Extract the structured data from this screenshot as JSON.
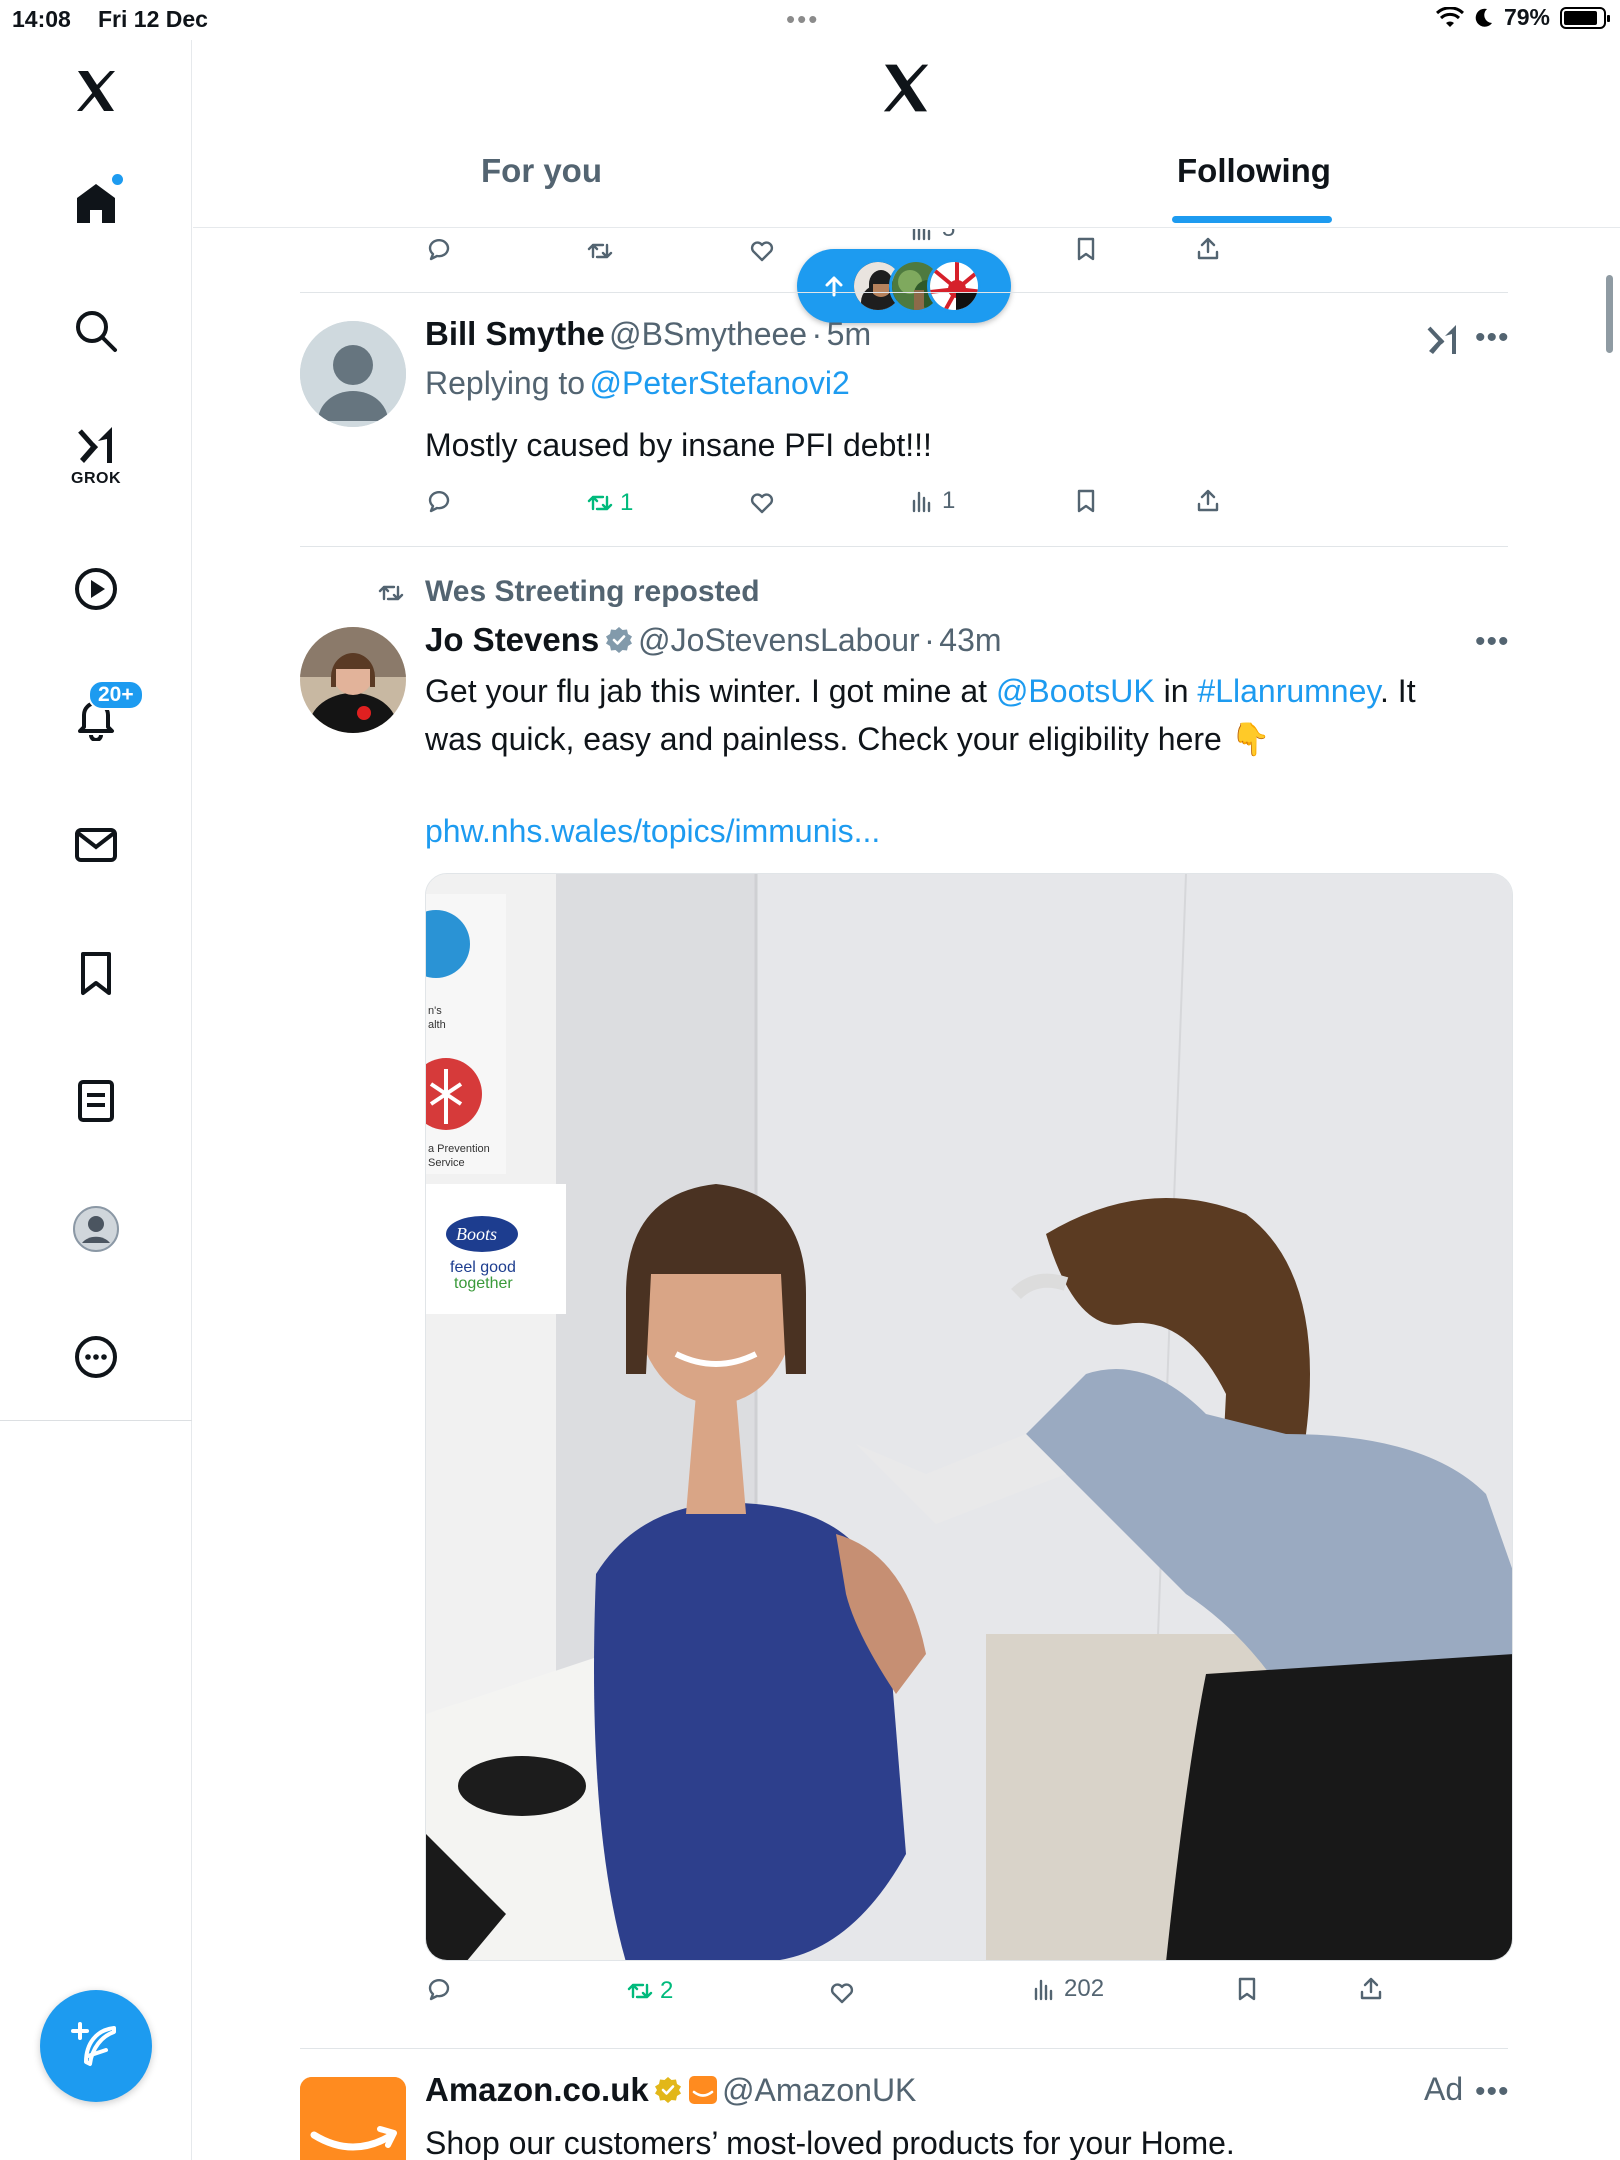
{
  "status_bar": {
    "time": "14:08",
    "date": "Fri 12 Dec",
    "battery": "79%",
    "battery_level": 0.79
  },
  "sidebar": {
    "items": [
      {
        "name": "home",
        "icon": "home-icon",
        "active": true,
        "dot": true
      },
      {
        "name": "explore",
        "icon": "search-icon"
      },
      {
        "name": "grok",
        "icon": "grok-icon",
        "label": "GROK"
      },
      {
        "name": "video",
        "icon": "play-icon"
      },
      {
        "name": "notifications",
        "icon": "bell-icon",
        "badge": "20+"
      },
      {
        "name": "messages",
        "icon": "mail-icon"
      },
      {
        "name": "bookmarks",
        "icon": "bookmark-icon"
      },
      {
        "name": "articles",
        "icon": "article-icon"
      },
      {
        "name": "profile",
        "icon": "profile-icon"
      },
      {
        "name": "more",
        "icon": "more-icon"
      }
    ],
    "compose_icon": "compose-icon"
  },
  "header": {
    "tabs": [
      {
        "label": "For you",
        "active": false
      },
      {
        "label": "Following",
        "active": true
      }
    ]
  },
  "new_posts_pill": {
    "icon": "arrow-up-icon"
  },
  "tweets": [
    {
      "partial": true,
      "actions": {
        "views": "5"
      }
    },
    {
      "name": "Bill Smythe",
      "handle": "@BSmytheee",
      "time": "5m",
      "replying_to_prefix": "Replying to",
      "replying_to": "@PeterStefanovi2",
      "text": "Mostly caused by insane PFI debt!!!",
      "actions": {
        "replies": "",
        "reposts": "1",
        "likes": "",
        "views": "1"
      }
    },
    {
      "reposted_by": "Wes Streeting reposted",
      "name": "Jo Stevens",
      "verified": true,
      "handle": "@JoStevensLabour",
      "time": "43m",
      "text_parts": [
        "Get your flu jab this winter. I got mine at ",
        "@BootsUK",
        " in ",
        "#Llanrumney",
        ". It",
        "was quick, easy and painless. Check your eligibility here",
        "👇"
      ],
      "link": "phw.nhs.wales/topics/immunis...",
      "media": {
        "description_labels": [
          "n's",
          "alth",
          "a Prevention",
          "Service",
          "Boots",
          "feel good",
          "together"
        ]
      },
      "actions": {
        "replies": "",
        "reposts": "2",
        "likes": "",
        "views": "202"
      }
    },
    {
      "name": "Amazon.co.uk",
      "handle": "@AmazonUK",
      "ad_label": "Ad",
      "text": "Shop our customers’ most-loved products for your Home."
    }
  ],
  "colors": {
    "accent": "#1d9bf0",
    "repost_green": "#00ba7c",
    "muted_text": "#536471",
    "amazon_orange": "#ff8b1f"
  }
}
